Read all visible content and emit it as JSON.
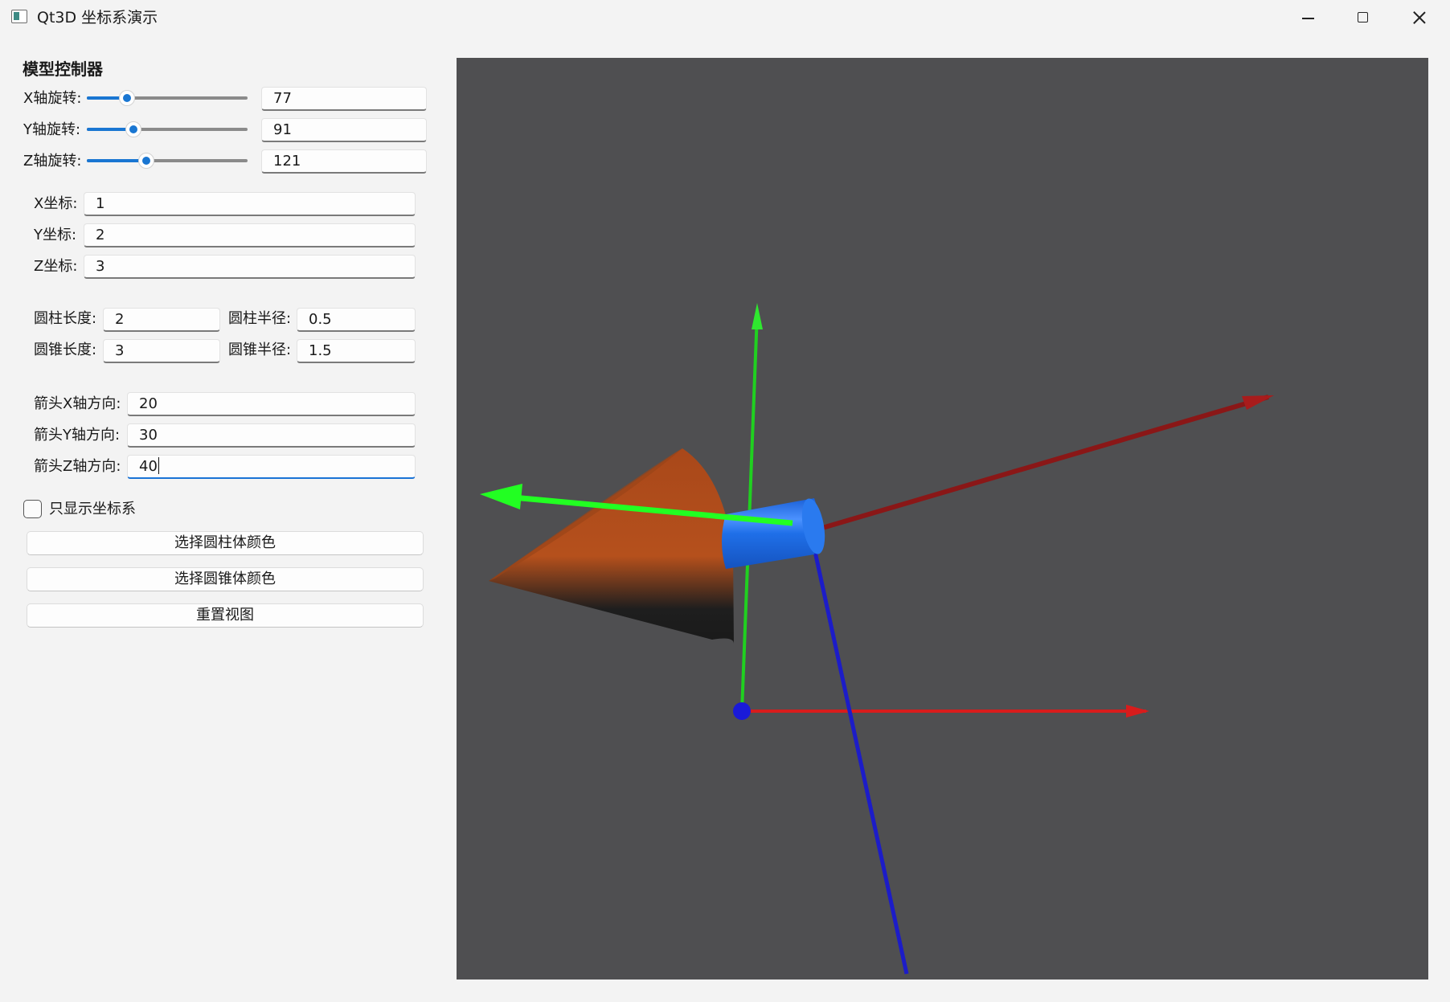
{
  "window": {
    "title": "Qt3D 坐标系演示",
    "icon": "qt-window-icon"
  },
  "controls": {
    "heading": "模型控制器",
    "rotation": [
      {
        "label": "X轴旋转:",
        "value": "77",
        "slider_fraction": 0.25
      },
      {
        "label": "Y轴旋转:",
        "value": "91",
        "slider_fraction": 0.29
      },
      {
        "label": "Z轴旋转:",
        "value": "121",
        "slider_fraction": 0.37
      }
    ],
    "position": [
      {
        "label": "X坐标:",
        "value": "1"
      },
      {
        "label": "Y坐标:",
        "value": "2"
      },
      {
        "label": "Z坐标:",
        "value": "3"
      }
    ],
    "dimensions": {
      "cylinder_length_label": "圆柱长度:",
      "cylinder_length": "2",
      "cylinder_radius_label": "圆柱半径:",
      "cylinder_radius": "0.5",
      "cone_length_label": "圆锥长度:",
      "cone_length": "3",
      "cone_radius_label": "圆锥半径:",
      "cone_radius": "1.5"
    },
    "arrow": [
      {
        "label": "箭头X轴方向:",
        "value": "20"
      },
      {
        "label": "箭头Y轴方向:",
        "value": "30"
      },
      {
        "label": "箭头Z轴方向:",
        "value": "40"
      }
    ],
    "only_axes": {
      "label": "只显示坐标系",
      "checked": false
    },
    "buttons": {
      "cylinder_color": "选择圆柱体颜色",
      "cone_color": "选择圆锥体颜色",
      "reset_view": "重置视图"
    }
  },
  "viewport": {
    "background": "#4f4f51",
    "colors": {
      "x_axis": "#e01e1e",
      "y_axis": "#1ee01e",
      "z_axis": "#2222cc",
      "cylinder": "#1f6fe8",
      "cone": "#b5501c",
      "arrow": "#33ee33"
    }
  }
}
